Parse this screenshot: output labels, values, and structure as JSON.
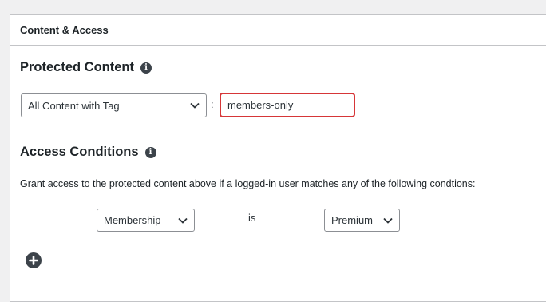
{
  "panel": {
    "title": "Content & Access"
  },
  "protected_content": {
    "heading": "Protected Content",
    "info_icon": "info-icon",
    "select_value": "All Content with Tag",
    "separator": ":",
    "tag_value": "members-only"
  },
  "access_conditions": {
    "heading": "Access Conditions",
    "info_icon": "info-icon",
    "description": "Grant access to the protected content above if a logged-in user matches any of the following condtions:",
    "condition": {
      "field": "Membership",
      "operator": "is",
      "value": "Premium"
    },
    "add_icon": "plus-circle-icon"
  },
  "colors": {
    "accent_error": "#d63638",
    "icon_dark": "#3c434a"
  }
}
